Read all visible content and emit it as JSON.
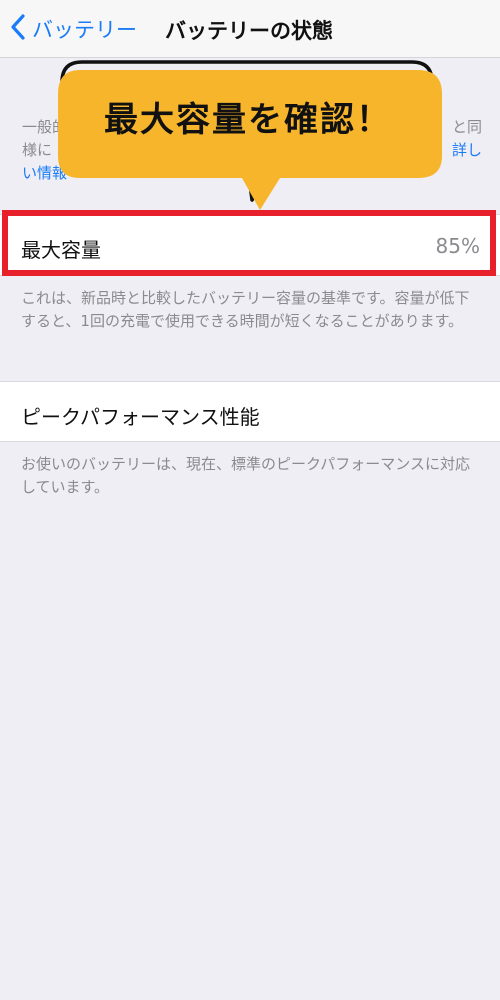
{
  "nav": {
    "back_label": "バッテリー",
    "title": "バッテリーの状態"
  },
  "top_description": {
    "line1_left": "一般的",
    "line1_right": "と同",
    "line2_left": "様に",
    "line2_right": "詳し",
    "line3_left": "い情報"
  },
  "callout": {
    "text": "最大容量を確認！",
    "fill_color": "#f7b52c"
  },
  "max_capacity": {
    "label": "最大容量",
    "value": "85%",
    "description": "これは、新品時と比較したバッテリー容量の基準です。容量が低下すると、1回の充電で使用できる時間が短くなることがあります。"
  },
  "peak_performance": {
    "label": "ピークパフォーマンス性能",
    "description": "お使いのバッテリーは、現在、標準のピークパフォーマンスに対応しています。"
  },
  "colors": {
    "accent": "#1a7cf6",
    "highlight": "#e8202b",
    "background": "#efeef4"
  }
}
